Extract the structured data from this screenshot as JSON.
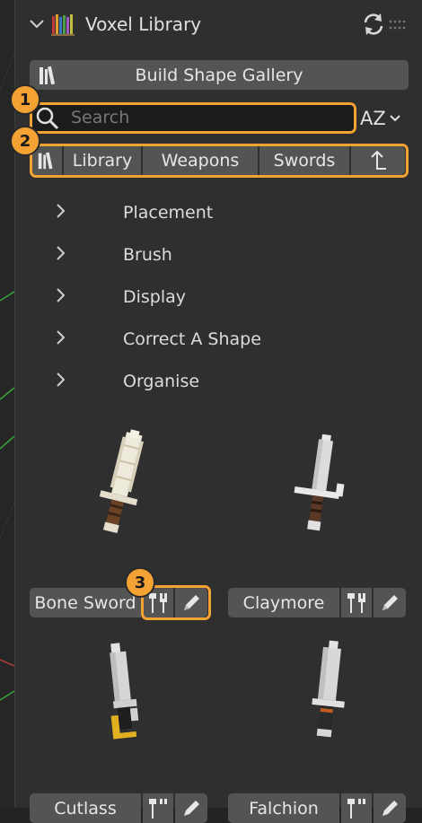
{
  "header": {
    "title": "Voxel Library"
  },
  "build_gallery_label": "Build Shape Gallery",
  "search": {
    "placeholder": "Search",
    "sort_label": "AZ"
  },
  "breadcrumb": {
    "items": [
      "Library",
      "Weapons",
      "Swords"
    ]
  },
  "sections": [
    "Placement",
    "Brush",
    "Display",
    "Correct A Shape",
    "Organise"
  ],
  "items": [
    {
      "name": "Bone Sword"
    },
    {
      "name": "Claymore"
    },
    {
      "name": "Cutlass"
    },
    {
      "name": "Falchion"
    }
  ],
  "badges": [
    "1",
    "2",
    "3"
  ],
  "colors": {
    "highlight": "#f5a234",
    "panel_bg": "#2f2f2f",
    "button_bg": "#545454",
    "search_bg": "#1c1c1c"
  }
}
